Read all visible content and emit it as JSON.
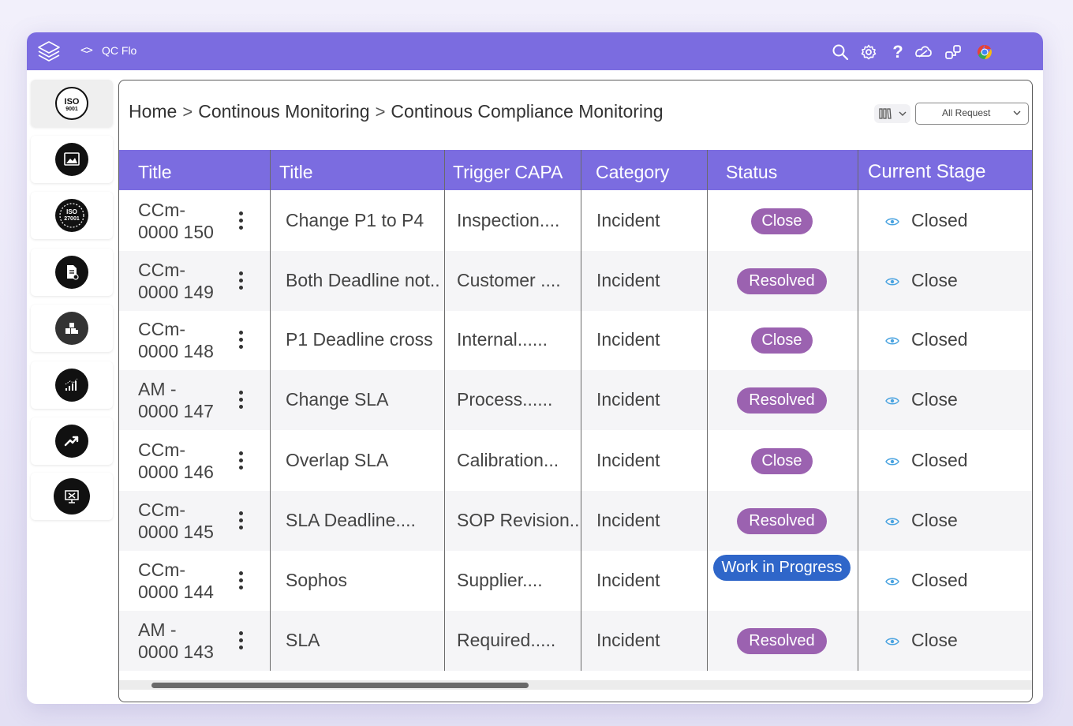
{
  "app": {
    "title": "QC Flo",
    "brand_color": "#7b6ce0"
  },
  "toolbar": {
    "icons": [
      "search-icon",
      "gear-icon",
      "help-icon",
      "integrations-icon",
      "workflow-icon",
      "chrome-icon"
    ],
    "help_glyph": "?"
  },
  "sidebar": {
    "items": [
      {
        "name": "iso-9001",
        "label": "ISO 9001"
      },
      {
        "name": "image-report",
        "label": ""
      },
      {
        "name": "iso-27001",
        "label": "ISO 27001"
      },
      {
        "name": "document-settings",
        "label": ""
      },
      {
        "name": "blocks",
        "label": ""
      },
      {
        "name": "signal-chart",
        "label": ""
      },
      {
        "name": "trend-up",
        "label": ""
      },
      {
        "name": "monitor-tools",
        "label": ""
      }
    ]
  },
  "breadcrumb": {
    "items": [
      "Home",
      "Continous Monitoring",
      "Continous Compliance Monitoring"
    ],
    "separator": ">"
  },
  "filter": {
    "view_icon": "columns-icon",
    "request_select": "All Request"
  },
  "table": {
    "columns": [
      "Title",
      "Title",
      "Trigger CAPA",
      "Category",
      "Status",
      "Current Stage"
    ],
    "rows": [
      {
        "id_line1": "CCm-",
        "id_line2": "0000 150",
        "title": "Change P1 to P4",
        "trigger": "Inspection....",
        "category": "Incident",
        "status": "Close",
        "stage": "Closed"
      },
      {
        "id_line1": "CCm-",
        "id_line2": "0000 149",
        "title": "Both Deadline not..",
        "trigger": "Customer ....",
        "category": "Incident",
        "status": "Resolved",
        "stage": "Close"
      },
      {
        "id_line1": "CCm-",
        "id_line2": "0000 148",
        "title": "P1 Deadline cross",
        "trigger": "Internal......",
        "category": "Incident",
        "status": "Close",
        "stage": "Closed"
      },
      {
        "id_line1": "AM -",
        "id_line2": "0000 147",
        "title": "Change SLA",
        "trigger": "Process......",
        "category": "Incident",
        "status": "Resolved",
        "stage": "Close"
      },
      {
        "id_line1": "CCm-",
        "id_line2": "0000 146",
        "title": "Overlap SLA",
        "trigger": "Calibration...",
        "category": "Incident",
        "status": "Close",
        "stage": "Closed"
      },
      {
        "id_line1": "CCm-",
        "id_line2": "0000 145",
        "title": "SLA Deadline....",
        "trigger": "SOP Revision..",
        "category": "Incident",
        "status": "Resolved",
        "stage": "Close"
      },
      {
        "id_line1": "CCm-",
        "id_line2": "0000 144",
        "title": "Sophos",
        "trigger": "Supplier....",
        "category": "Incident",
        "status": "Work in Progress",
        "stage": "Closed"
      },
      {
        "id_line1": "AM -",
        "id_line2": "0000 143",
        "title": "SLA",
        "trigger": "Required.....",
        "category": "Incident",
        "status": "Resolved",
        "stage": "Close"
      }
    ],
    "status_colors": {
      "Close": "#9b62b0",
      "Resolved": "#9b62b0",
      "Work in Progress": "#2f66c9"
    }
  }
}
